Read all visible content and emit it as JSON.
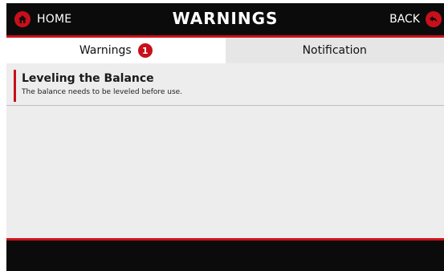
{
  "header": {
    "home_label": "HOME",
    "title": "WARNINGS",
    "back_label": "BACK",
    "home_icon": "home-icon",
    "back_icon": "back-arrow-icon"
  },
  "tabs": [
    {
      "label": "Warnings",
      "badge": "1",
      "active": true
    },
    {
      "label": "Notification",
      "active": false
    }
  ],
  "warnings": [
    {
      "title": "Leveling the Balance",
      "description": "The balance needs to be leveled before use."
    }
  ],
  "colors": {
    "accent": "#c8101a",
    "header_bg": "#0b0b0b",
    "content_bg": "#ededed"
  }
}
